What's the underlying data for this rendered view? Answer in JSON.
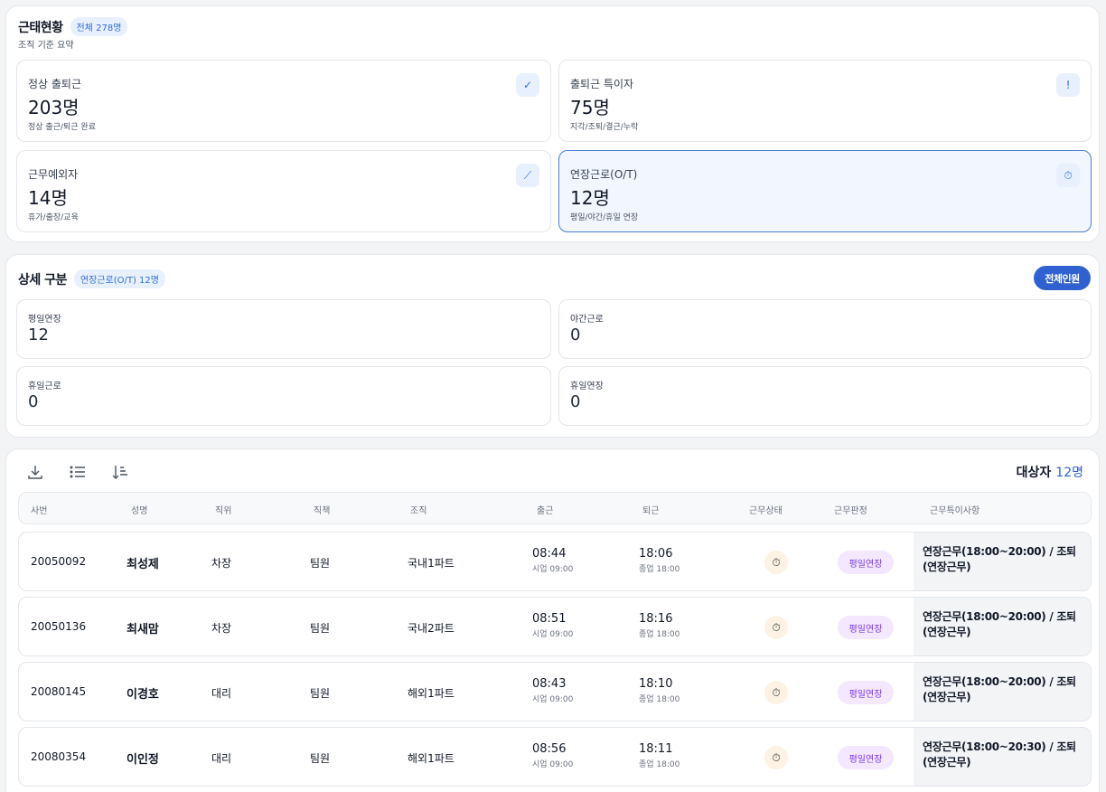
{
  "summary": {
    "title": "근태현황",
    "total_badge": "전체 278명",
    "subtitle": "조직 기준 요약",
    "cards": [
      {
        "label": "정상 출퇴근",
        "value": "203명",
        "desc": "정상 출근/퇴근 완료",
        "icon": "check-icon",
        "glyph": "✓"
      },
      {
        "label": "출퇴근 특이자",
        "value": "75명",
        "desc": "지각/조퇴/결근/누락",
        "icon": "exclamation-icon",
        "glyph": "!"
      },
      {
        "label": "근무예외자",
        "value": "14명",
        "desc": "휴가/출장/교육",
        "icon": "slash-icon",
        "glyph": "⟋"
      },
      {
        "label": "연장근로(O/T)",
        "value": "12명",
        "desc": "평일/야간/휴일 연장",
        "icon": "stopwatch-icon",
        "glyph": "⏱"
      }
    ]
  },
  "detail": {
    "title": "상세 구분",
    "badge": "연장근로(O/T) 12명",
    "all_button": "전체인원",
    "items": [
      {
        "label": "평일연장",
        "value": "12"
      },
      {
        "label": "야간근로",
        "value": "0"
      },
      {
        "label": "휴일근로",
        "value": "0"
      },
      {
        "label": "휴일연장",
        "value": "0"
      }
    ]
  },
  "list": {
    "count_label": "대상자",
    "count_value": "12명",
    "columns": [
      "사번",
      "성명",
      "직위",
      "직책",
      "조직",
      "출근",
      "퇴근",
      "근무상태",
      "근무판정",
      "근무특이사항"
    ],
    "rows": [
      {
        "id": "20050092",
        "name": "최성제",
        "rank": "차장",
        "role": "팀원",
        "org": "국내1파트",
        "in": "08:44",
        "in_sub": "시업 09:00",
        "out": "18:06",
        "out_sub": "종업 18:00",
        "judge": "평일연장",
        "note": "연장근무(18:00~20:00) / 조퇴(연장근무)"
      },
      {
        "id": "20050136",
        "name": "최새맘",
        "rank": "차장",
        "role": "팀원",
        "org": "국내2파트",
        "in": "08:51",
        "in_sub": "시업 09:00",
        "out": "18:16",
        "out_sub": "종업 18:00",
        "judge": "평일연장",
        "note": "연장근무(18:00~20:00) / 조퇴(연장근무)"
      },
      {
        "id": "20080145",
        "name": "이경호",
        "rank": "대리",
        "role": "팀원",
        "org": "해외1파트",
        "in": "08:43",
        "in_sub": "시업 09:00",
        "out": "18:10",
        "out_sub": "종업 18:00",
        "judge": "평일연장",
        "note": "연장근무(18:00~20:00) / 조퇴(연장근무)"
      },
      {
        "id": "20080354",
        "name": "이인정",
        "rank": "대리",
        "role": "팀원",
        "org": "해외1파트",
        "in": "08:56",
        "in_sub": "시업 09:00",
        "out": "18:11",
        "out_sub": "종업 18:00",
        "judge": "평일연장",
        "note": "연장근무(18:00~20:30) / 조퇴(연장근무)"
      }
    ],
    "toolbar_icons": [
      "download-icon",
      "list-icon",
      "sort-icon"
    ]
  },
  "colors": {
    "accent": "#2f62d0",
    "badge_bg": "#e8f0fe",
    "judge_bg": "#f3e8ff",
    "judge_text": "#7c3aed"
  }
}
